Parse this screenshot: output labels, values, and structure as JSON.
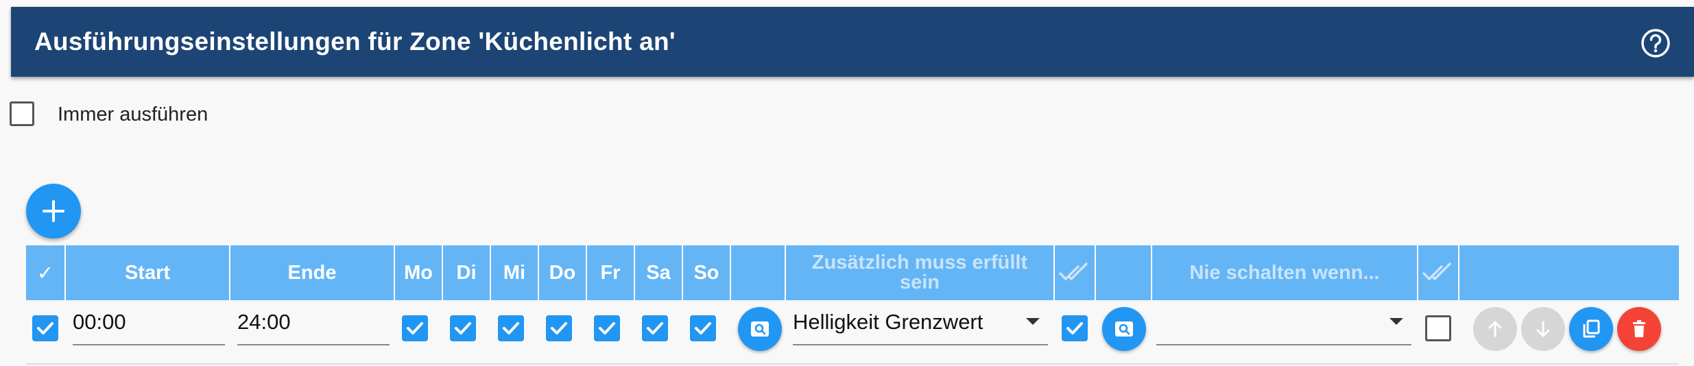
{
  "header": {
    "title": "Ausführungseinstellungen für Zone 'Küchenlicht an'",
    "help_icon": "help-circle-icon"
  },
  "always_run": {
    "label": "Immer ausführen",
    "checked": false
  },
  "add_button": {
    "icon": "plus-icon"
  },
  "table": {
    "columns": {
      "check": "✓",
      "start": "Start",
      "end": "Ende",
      "days": [
        "Mo",
        "Di",
        "Mi",
        "Do",
        "Fr",
        "Sa",
        "So"
      ],
      "additional": "Zusätzlich muss erfüllt sein",
      "additional_icon": "double-check-icon",
      "never": "Nie schalten wenn...",
      "never_icon": "double-check-icon"
    },
    "row": {
      "enabled": true,
      "start": "00:00",
      "end": "24:00",
      "days_checked": [
        true,
        true,
        true,
        true,
        true,
        true,
        true
      ],
      "additional_value": "Helligkeit Grenzwert",
      "additional_all": true,
      "never_value": "",
      "never_all": false
    }
  },
  "colors": {
    "header_bg": "#1c4575",
    "table_header_bg": "#64b5f6",
    "accent": "#2196f3",
    "delete": "#f44336",
    "disabled": "#d6d6d6"
  }
}
